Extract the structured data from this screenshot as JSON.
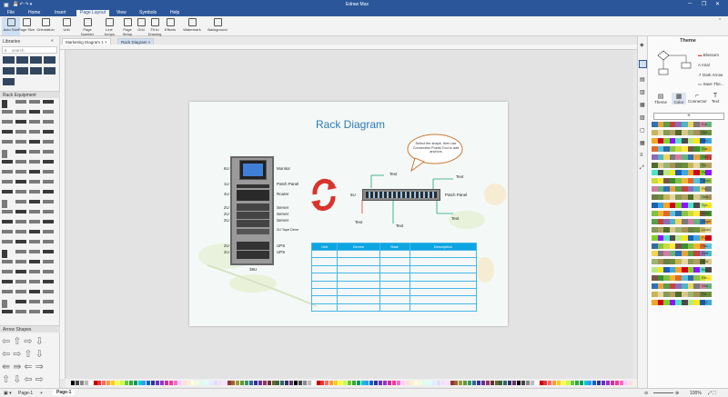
{
  "window": {
    "title": "Edraw Max",
    "controls": [
      "─",
      "❐",
      "✕"
    ]
  },
  "menu": [
    "File",
    "Home",
    "Insert",
    "Page Layout",
    "View",
    "Symbols",
    "Help"
  ],
  "menu_active": "Page Layout",
  "ribbon": [
    "Auto Size",
    "Page Size",
    "Orientation",
    "Unit",
    "Page Number",
    "Line Jumps",
    "Page Setup",
    "Grid",
    "Fit to Drawing",
    "Effects",
    "Watermark",
    "Background"
  ],
  "left_panel": {
    "title": "Libraries",
    "search_placeholder": "search",
    "section1": "Rack Equipment",
    "section2": "Arrow Shapes"
  },
  "tabs": [
    "Marketing Diagram 1",
    "Rack Diagram"
  ],
  "diagram": {
    "title": "Rack Diagram",
    "callout": "Select the shape, then use Connection Points Tool to add anchors",
    "rack_left_labels": [
      "6U",
      "1U",
      "4U",
      "2U",
      "2U",
      "2U",
      "2U",
      "2U"
    ],
    "rack_right_labels": [
      "Monitor",
      "Patch Panel",
      "Router",
      "Server",
      "Server",
      "Server",
      "2U Tape Drive",
      "UPS",
      "UPS"
    ],
    "rack_bottom": "39U",
    "patch_label": "Patch Panel",
    "patch_left": "6U",
    "text_labels": [
      "Text",
      "Text",
      "Text",
      "Text",
      "Text"
    ],
    "table_headers": [
      "Unit",
      "Device",
      "Rate",
      "Description"
    ]
  },
  "right_panel": {
    "title": "Theme",
    "themes": [
      "Blossom",
      "Arial",
      "Dark Arrow",
      "Save The..."
    ],
    "tabs": [
      "Theme",
      "Color",
      "Connector",
      "Text"
    ],
    "add": "+",
    "palettes": [
      "Edr...",
      "Nat...",
      "Ele...",
      "Gar...",
      "Can...",
      "Bu...",
      "Fle...",
      "Town",
      "Flu...",
      "Sea...",
      "Spr...",
      "Brisk",
      "Angel",
      "Lucid",
      "Pur...",
      "Har...",
      "Soft",
      "Mild",
      "Bus...",
      "Ele...",
      "Vita...",
      "Ele...",
      "Vivi..."
    ]
  },
  "status": {
    "page_label": "Page-1",
    "page_name": "Page-1",
    "zoom": "100%",
    "add": "+"
  }
}
